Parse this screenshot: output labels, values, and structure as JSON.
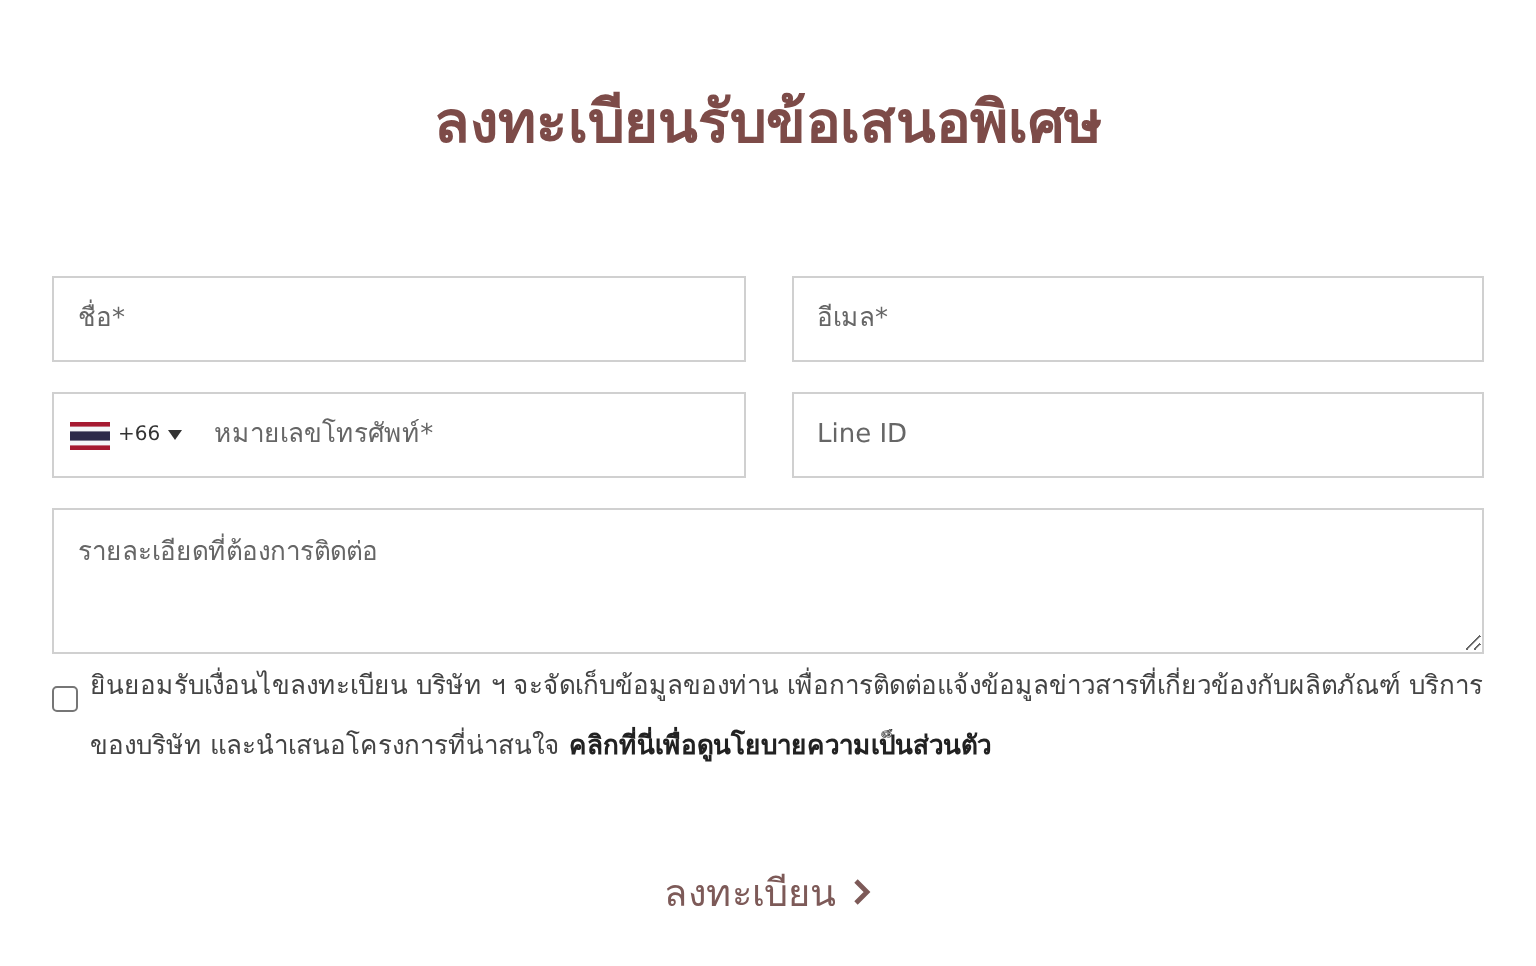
{
  "title": "ลงทะเบียนรับข้อเสนอพิเศษ",
  "fields": [
    {
      "kind": "text",
      "placeholder": "ชื่อ*"
    },
    {
      "kind": "text",
      "placeholder": "อีเมล*"
    },
    {
      "kind": "phone",
      "country_code": "+66",
      "placeholder": "หมายเลขโทรศัพท์*"
    },
    {
      "kind": "text",
      "placeholder": "Line ID"
    },
    {
      "kind": "textarea",
      "placeholder": "รายละเอียดที่ต้องการติดต่อ"
    }
  ],
  "consent": {
    "checked": false,
    "text": "ยินยอมรับเงื่อนไขลงทะเบียน บริษัท ฯ จะจัดเก็บข้อมูลของท่าน เพื่อการติดต่อแจ้งข้อมูลข่าวสารที่เกี่ยวข้องกับผลิตภัณฑ์ บริการของบริษัท และนำเสนอโครงการที่น่าสนใจ",
    "link": "คลิกที่นี่เพื่อดูนโยบายความเป็นส่วนตัว"
  },
  "submit": {
    "label": "ลงทะเบียน"
  }
}
